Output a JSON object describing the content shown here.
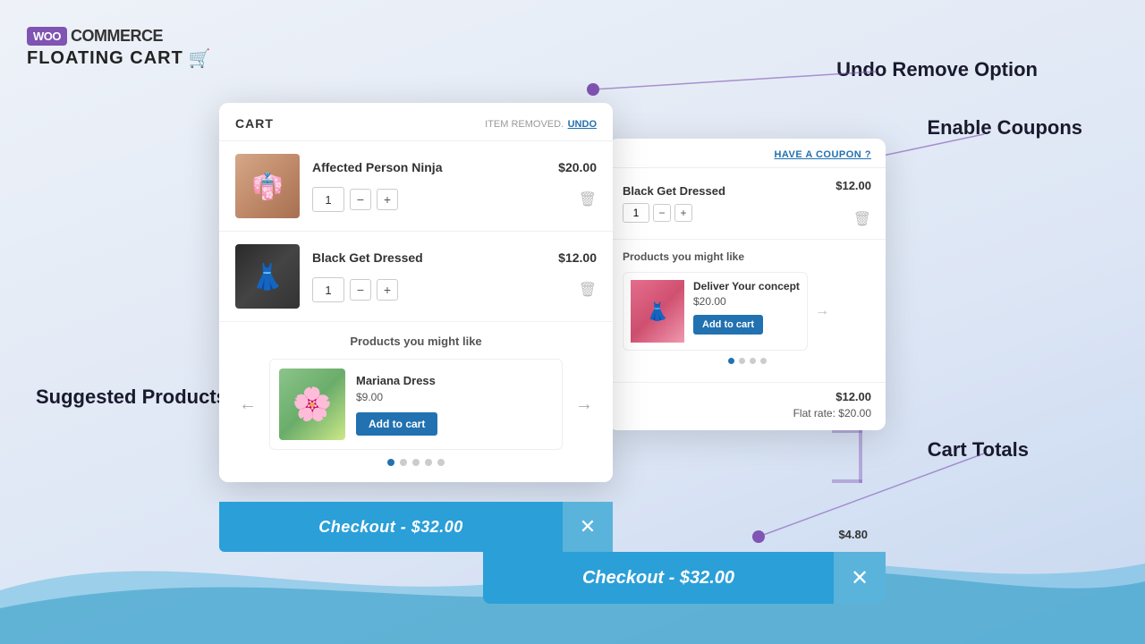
{
  "logo": {
    "badge": "WOO",
    "commerce": "COMMERCE",
    "floating_cart": "FLOATING CART"
  },
  "feature_labels": {
    "undo_remove": "Undo Remove Option",
    "enable_coupons": "Enable Coupons",
    "suggested_products": "Suggested Products",
    "cart_totals": "Cart Totals"
  },
  "front_cart": {
    "title": "CART",
    "item_removed": "ITEM REMOVED.",
    "undo": "UNDO",
    "items": [
      {
        "name": "Affected Person Ninja",
        "price": "$20.00",
        "qty": "1"
      },
      {
        "name": "Black Get Dressed",
        "price": "$12.00",
        "qty": "1"
      }
    ],
    "suggested": {
      "title": "Products you might like",
      "product_name": "Mariana Dress",
      "product_price": "$9.00",
      "add_to_cart": "Add to cart",
      "dots": 5,
      "active_dot": 0
    },
    "checkout": "Checkout - $32.00"
  },
  "back_cart": {
    "coupon_link": "HAVE A COUPON ?",
    "item_name": "Black Get Dressed",
    "item_price": "$12.00",
    "item_qty": "1",
    "suggested": {
      "title": "Products you might like",
      "product_name": "Deliver Your concept",
      "product_price": "$20.00",
      "add_to_cart": "Add to cart",
      "dots": 4,
      "active_dot": 0
    },
    "subtotal": "$12.00",
    "shipping_label": "Flat rate:",
    "shipping_price": "$20.00",
    "extra_charge": "$4.80",
    "checkout": "Checkout - $32.00"
  },
  "icons": {
    "minus": "−",
    "plus": "+",
    "trash": "🗑",
    "close": "✕",
    "arrow_left": "←",
    "arrow_right": "→",
    "cart_small": "🛒"
  }
}
